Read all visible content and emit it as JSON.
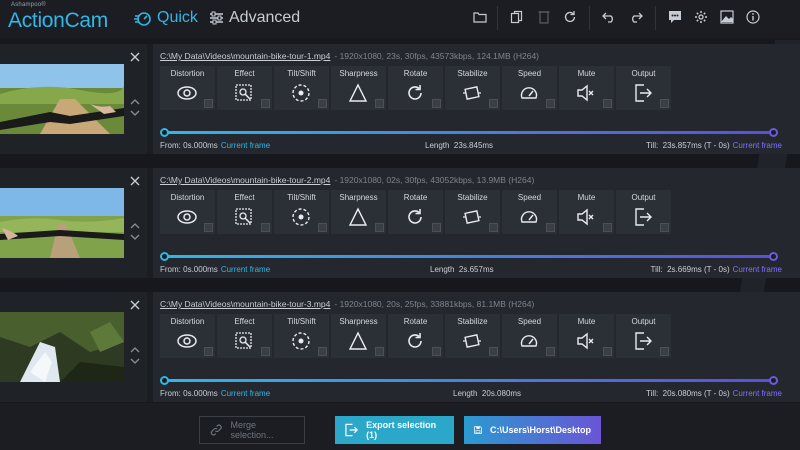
{
  "app": {
    "brand": "Ashampoo®",
    "name": "ActionCam"
  },
  "modes": {
    "quick": "Quick",
    "advanced": "Advanced"
  },
  "toolbar": [
    "folder-icon",
    "copy-icon",
    "delete-icon",
    "reset-icon",
    "undo-icon",
    "redo-icon",
    "chat-icon",
    "gear-icon",
    "image-icon",
    "info-icon"
  ],
  "tools": [
    "Distortion",
    "Effect",
    "Tilt/Shift",
    "Sharpness",
    "Rotate",
    "Stabilize",
    "Speed",
    "Mute",
    "Output"
  ],
  "labels": {
    "from": "From:",
    "current_frame": "Current frame",
    "length": "Length",
    "till": "Till:"
  },
  "videos": [
    {
      "path": "C:\\My Data\\Videos\\mountain-bike-tour-1.mp4",
      "meta": "-   1920x1080, 23s, 30fps, 43573kbps, 124.1MB (H264)",
      "from": "0s.000ms",
      "length": "23s.845ms",
      "till": "23s.857ms (T - 0s)"
    },
    {
      "path": "C:\\My Data\\Videos\\mountain-bike-tour-2.mp4",
      "meta": "-   1920x1080, 02s, 30fps, 43052kbps, 13.9MB (H264)",
      "from": "0s.000ms",
      "length": "2s.657ms",
      "till": "2s.669ms (T - 0s)"
    },
    {
      "path": "C:\\My Data\\Videos\\mountain-bike-tour-3.mp4",
      "meta": "-   1920x1080, 20s, 25fps, 33881kbps, 81.1MB (H264)",
      "from": "0s.000ms",
      "length": "20s.080ms",
      "till": "20s.080ms (T - 0s)"
    }
  ],
  "footer": {
    "merge": "Merge selection...",
    "export": "Export selection (1)",
    "destination": "C:\\Users\\Horst\\Desktop"
  },
  "colors": {
    "accent": "#2fb7e6",
    "purple": "#7f73ff",
    "background": "#16181d"
  }
}
